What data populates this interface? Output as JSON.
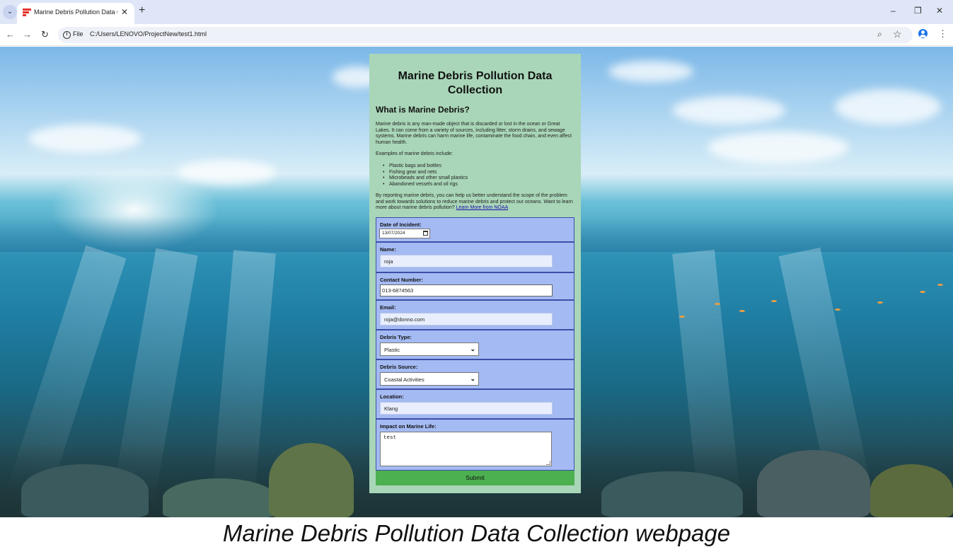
{
  "browser": {
    "tab_title": "Marine Debris Pollution Data C",
    "tab_close": "✕",
    "new_tab": "+",
    "tab_menu": "⌄",
    "file_label": "File",
    "url": "C:/Users/LENOVO/ProjectNew/test1.html",
    "controls": {
      "minimize": "–",
      "restore": "❐",
      "close": "✕"
    },
    "nav": {
      "back": "←",
      "forward": "→",
      "reload": "↻"
    }
  },
  "page": {
    "title": "Marine Debris Pollution Data Collection",
    "intro_heading": "What is Marine Debris?",
    "intro_paragraph": "Marine debris is any man-made object that is discarded or lost in the ocean or Great Lakes. It can come from a variety of sources, including litter, storm drains, and sewage systems. Marine debris can harm marine life, contaminate the food chain, and even affect human health.",
    "examples_intro": "Examples of marine debris include:",
    "examples": [
      "Plastic bags and bottles",
      "Fishing gear and nets",
      "Microbeads and other small plastics",
      "Abandoned vessels and oil rigs"
    ],
    "closing_paragraph": "By reporting marine debris, you can help us better understand the scope of the problem and work towards solutions to reduce marine debris and protect our oceans. Want to learn more about marine debris pollution?",
    "learn_more_link": "Learn More from NOAA"
  },
  "form": {
    "date": {
      "label": "Date of Incident:",
      "value": "13/07/2024"
    },
    "name": {
      "label": "Name:",
      "value": "roja"
    },
    "contact": {
      "label": "Contact Number:",
      "value": "013-6874563"
    },
    "email": {
      "label": "Email:",
      "value": "roja@donno.com"
    },
    "debris_type": {
      "label": "Debris Type:",
      "value": "Plastic"
    },
    "debris_source": {
      "label": "Debris Source:",
      "value": "Coastal Activities"
    },
    "location": {
      "label": "Location:",
      "value": "Klang"
    },
    "impact": {
      "label": "Impact on Marine Life:",
      "value": "test"
    },
    "submit_label": "Submit"
  },
  "caption": "Marine Debris Pollution Data Collection webpage",
  "colors": {
    "card_bg": "#a9d6b8",
    "field_bg": "#a4baf2",
    "field_border": "#3b4fa8",
    "submit_bg": "#4caf50",
    "link": "#1a0dab"
  }
}
